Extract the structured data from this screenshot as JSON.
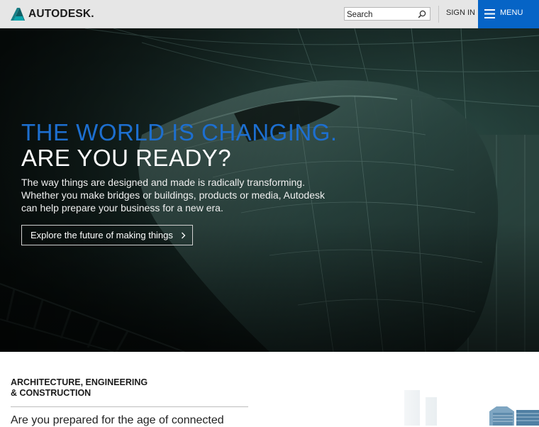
{
  "header": {
    "logo_text": "AUTODESK.",
    "search": {
      "placeholder": "Search",
      "value": ""
    },
    "sign_in_label": "SIGN IN",
    "menu_label": "MENU"
  },
  "hero": {
    "title_line1": "THE WORLD IS CHANGING.",
    "title_line2": "ARE YOU READY?",
    "body_lines": [
      "The way things are designed and made is radically transforming.",
      "Whether you make bridges or buildings, products or media, Autodesk",
      "can help prepare your business for a new era."
    ],
    "cta_label": "Explore the future of making things"
  },
  "section": {
    "heading_lines": [
      "ARCHITECTURE, ENGINEERING",
      "& CONSTRUCTION"
    ],
    "teaser": "Are you prepared for the age of connected"
  },
  "colors": {
    "header_bg": "#e6e6e6",
    "menu_bg": "#0664c6",
    "title_blue": "#1d6fd0",
    "logo_mark": "#0b8f97"
  }
}
